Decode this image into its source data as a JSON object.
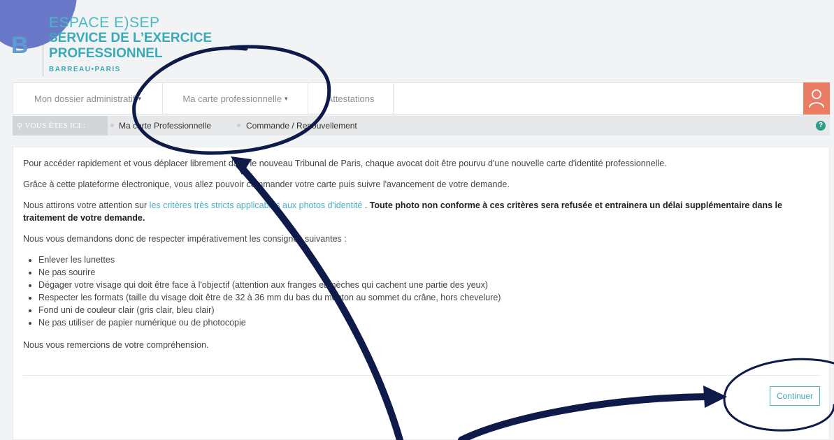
{
  "brand": {
    "espace": "ESPACE E)SEP",
    "service": "SERVICE DE L’EXERCICE",
    "professionnel": "PROFESSIONNEL",
    "barreau": "BARREAU•PARIS",
    "logo_letter": "B"
  },
  "nav": {
    "items": [
      {
        "label": "Mon dossier administratif",
        "has_caret": true
      },
      {
        "label": "Ma carte professionnelle",
        "has_caret": true
      },
      {
        "label": "Attestations",
        "has_caret": false
      }
    ],
    "caret": "▾"
  },
  "breadcrumb": {
    "here_label": "VOUS ÊTES ICI :",
    "items": [
      "Ma carte Professionnelle",
      "Commande / Renouvellement"
    ],
    "help": "?"
  },
  "content": {
    "p1": "Pour accéder rapidement et vous déplacer librement dans le nouveau Tribunal de Paris, chaque avocat doit être pourvu d'une nouvelle carte d'identité professionnelle.",
    "p2": "Grâce à cette plateforme électronique, vous allez pouvoir commander votre carte puis suivre l'avancement de votre demande.",
    "p3_before": "Nous attirons votre attention sur ",
    "p3_link": "les critères très stricts applicables aux photos d'identité",
    "p3_mid": " . ",
    "p3_bold": "Toute photo non conforme à ces critères sera refusée et entrainera un délai supplémentaire dans le traitement de votre demande.",
    "p4": "Nous vous demandons donc de respecter impérativement les consignes suivantes :",
    "list": [
      "Enlever les lunettes",
      "Ne pas sourire",
      "Dégager votre visage qui doit être face à l'objectif (attention aux franges et mèches qui cachent une partie des yeux)",
      "Respecter les formats (taille du visage doit être de 32 à 36 mm du bas du menton au sommet du crâne, hors chevelure)",
      "Fond uni de couleur clair (gris clair, bleu clair)",
      "Ne pas utiliser de papier numérique ou de photocopie"
    ],
    "p5": "Nous vous remercions de votre compréhension.",
    "continue_label": "Continuer"
  },
  "colors": {
    "accent_teal": "#3aa9b8",
    "user_button": "#ea7d63",
    "annotation_ink": "#0e1a4a",
    "corner_blob": "#6a78c9",
    "help_icon": "#2f9d8a"
  },
  "icons": {
    "user": "user-icon",
    "pin": "map-pin-icon",
    "help": "help-icon"
  }
}
